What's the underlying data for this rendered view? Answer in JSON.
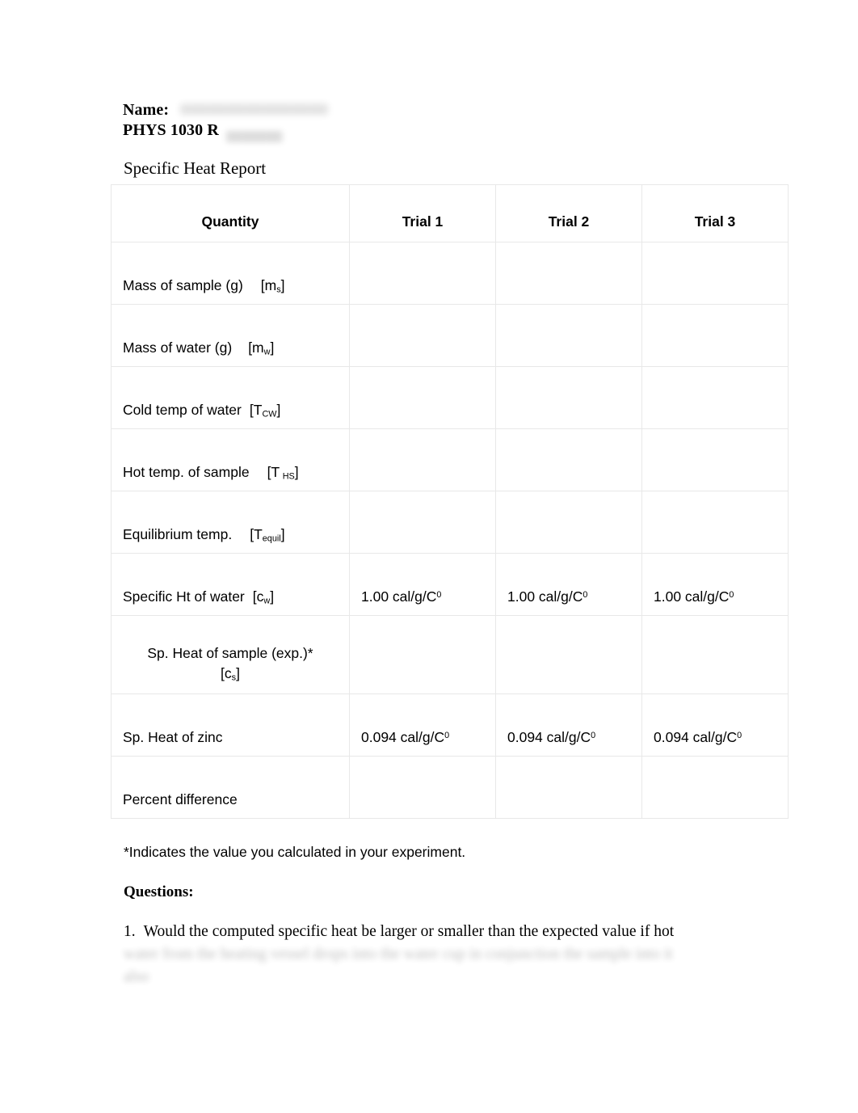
{
  "header": {
    "name_label": "Name:",
    "name_value_redacted": "████████████████",
    "course": "PHYS 1030 R",
    "course_note_redacted": "███████",
    "report_title": "Specific Heat Report"
  },
  "table": {
    "columns": [
      "Quantity",
      "Trial 1",
      "Trial 2",
      "Trial 3"
    ],
    "rows": [
      {
        "label": "Mass of sample (g)",
        "symbol_base": "[m",
        "symbol_sub": "s",
        "symbol_close": "]",
        "align": "left",
        "trial1": "",
        "trial2": "",
        "trial3": ""
      },
      {
        "label": "Mass of water (g)",
        "symbol_base": "[m",
        "symbol_sub": "w",
        "symbol_close": "]",
        "align": "left",
        "trial1": "",
        "trial2": "",
        "trial3": ""
      },
      {
        "label": "Cold temp of water",
        "symbol_base": "[T",
        "symbol_sub": "CW",
        "symbol_close": "]",
        "align": "left",
        "trial1": "",
        "trial2": "",
        "trial3": ""
      },
      {
        "label": "Hot temp. of sample",
        "symbol_base": "[T",
        "symbol_sub": "HS",
        "symbol_close": "]",
        "align": "left",
        "trial1": "",
        "trial2": "",
        "trial3": ""
      },
      {
        "label": "Equilibrium temp.",
        "symbol_base": "[T",
        "symbol_sub": "equil",
        "symbol_close": "]",
        "align": "left",
        "trial1": "",
        "trial2": "",
        "trial3": ""
      },
      {
        "label": "Specific Ht of water",
        "symbol_base": "[c",
        "symbol_sub": "w",
        "symbol_close": "]",
        "align": "left",
        "trial1_value": "1.00 cal/g/C",
        "trial1_sup": "0",
        "trial2_value": "1.00 cal/g/C",
        "trial2_sup": "0",
        "trial3_value": "1.00 cal/g/C",
        "trial3_sup": "0"
      },
      {
        "label": "Sp. Heat of sample (exp.)*",
        "symbol_base": "[c",
        "symbol_sub": "s",
        "symbol_close": "]",
        "align": "center",
        "trial1": "",
        "trial2": "",
        "trial3": ""
      },
      {
        "label": "Sp. Heat of zinc",
        "symbol_base": "",
        "symbol_sub": "",
        "symbol_close": "",
        "align": "left",
        "trial1_value": "0.094 cal/g/C",
        "trial1_sup": "0",
        "trial2_value": "0.094 cal/g/C",
        "trial2_sup": "0",
        "trial3_value": "0.094 cal/g/C",
        "trial3_sup": "0"
      },
      {
        "label": "Percent difference",
        "symbol_base": "",
        "symbol_sub": "",
        "symbol_close": "",
        "align": "left",
        "trial1": "",
        "trial2": "",
        "trial3": ""
      }
    ]
  },
  "footnote": "*Indicates the value you calculated in your experiment.",
  "questions": {
    "heading": "Questions:",
    "items": [
      {
        "number": "1.",
        "line1": "Would the computed specific heat be larger or smaller than the expected value if hot",
        "line2_redacted": "water from the heating vessel drops into the water cup in conjunction the sample into it",
        "line3_redacted": "also"
      }
    ]
  },
  "colors": {
    "page_background": "#ffffff",
    "text": "#000000",
    "table_border": "#e8e8e8"
  }
}
